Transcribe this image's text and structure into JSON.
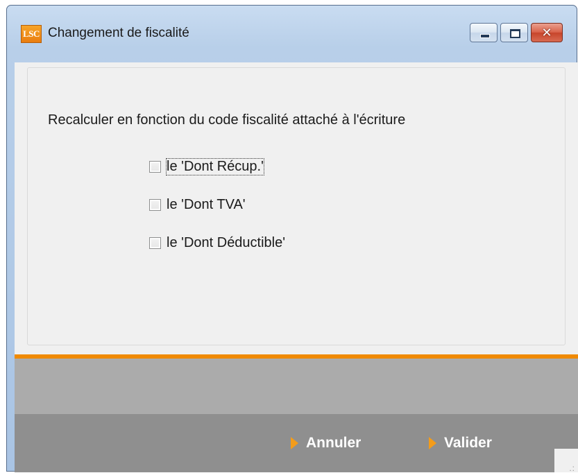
{
  "window": {
    "title": "Changement de fiscalité",
    "logo_text": "LSC",
    "controls": {
      "minimize_icon": "minimize-icon",
      "maximize_icon": "maximize-icon",
      "close_icon": "close-icon",
      "close_glyph": "✕"
    }
  },
  "dialog": {
    "prompt": "Recalculer en fonction du code fiscalité attaché à l'écriture",
    "checkboxes": [
      {
        "label": "le 'Dont Récup.'",
        "checked": false,
        "focused": true
      },
      {
        "label": "le 'Dont TVA'",
        "checked": false,
        "focused": false
      },
      {
        "label": "le 'Dont Déductible'",
        "checked": false,
        "focused": false
      }
    ]
  },
  "footer": {
    "cancel_label": "Annuler",
    "validate_label": "Valider"
  },
  "colors": {
    "accent": "#f08a00",
    "arrow": "#f39c1a",
    "footer": "#8f8f8f"
  }
}
